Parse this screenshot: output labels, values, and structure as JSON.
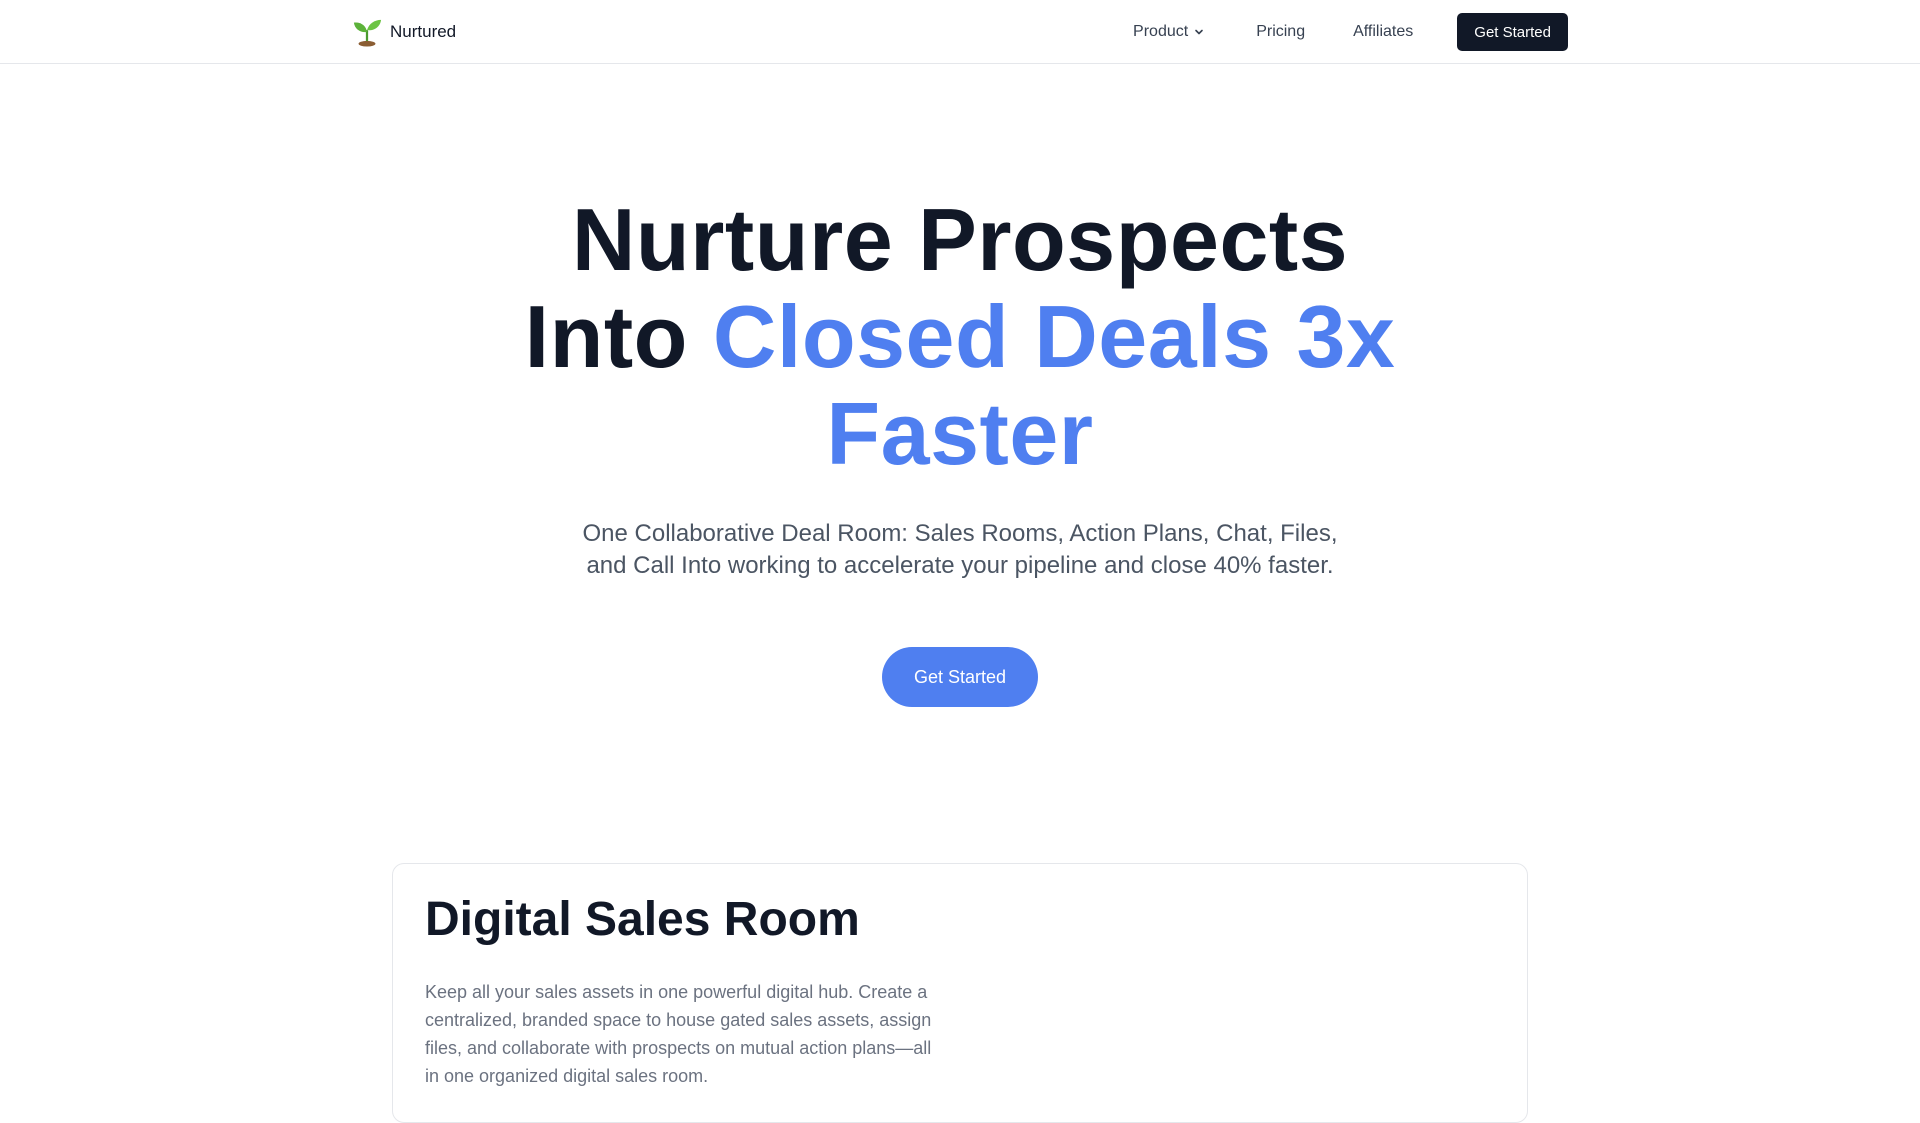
{
  "brand": {
    "name": "Nurtured",
    "icon": "seedling-icon"
  },
  "nav": {
    "product_label": "Product",
    "pricing_label": "Pricing",
    "affiliates_label": "Affiliates",
    "cta_label": "Get Started"
  },
  "hero": {
    "title_line1": "Nurture Prospects",
    "title_line2_plain": "Into",
    "title_highlight": "Closed Deals 3x Faster",
    "subtitle": "One Collaborative Deal Room: Sales Rooms, Action Plans, Chat, Files, and Call Into working to accelerate your pipeline and close 40% faster.",
    "cta_label": "Get Started"
  },
  "feature": {
    "title": "Digital Sales Room",
    "description": "Keep all your sales assets in one powerful digital hub. Create a centralized, branded space to house gated sales assets, assign files, and collaborate with prospects on mutual action plans—all in one organized digital sales room."
  },
  "colors": {
    "accent": "#4f7ff0",
    "dark": "#111827",
    "muted_text": "#6b7280",
    "border": "#e5e7eb"
  }
}
